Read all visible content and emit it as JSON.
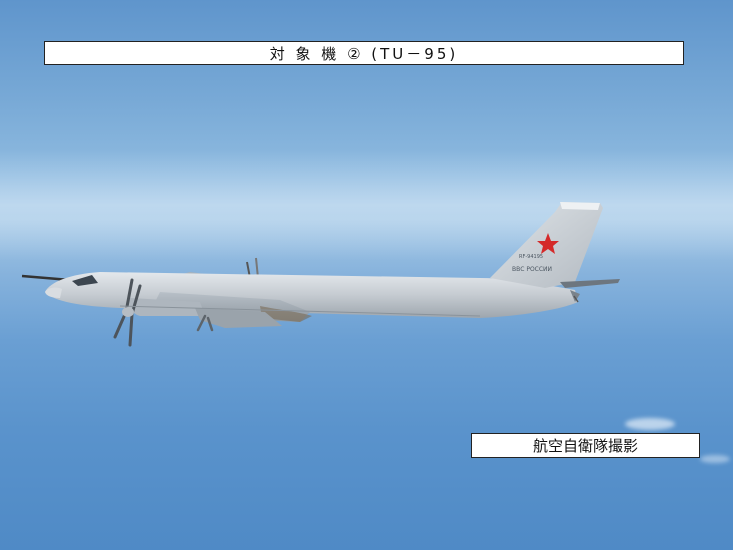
{
  "caption": {
    "title": "対 象 機 ② (TU－95)"
  },
  "credit": {
    "text": "航空自衛隊撮影"
  },
  "aircraft": {
    "registration": "RF-94195",
    "marking": "ВВС РОССИИ"
  },
  "colors": {
    "sky": "#6a9fd3",
    "fuselage": "#c9ced3",
    "star": "#d42a2a"
  }
}
